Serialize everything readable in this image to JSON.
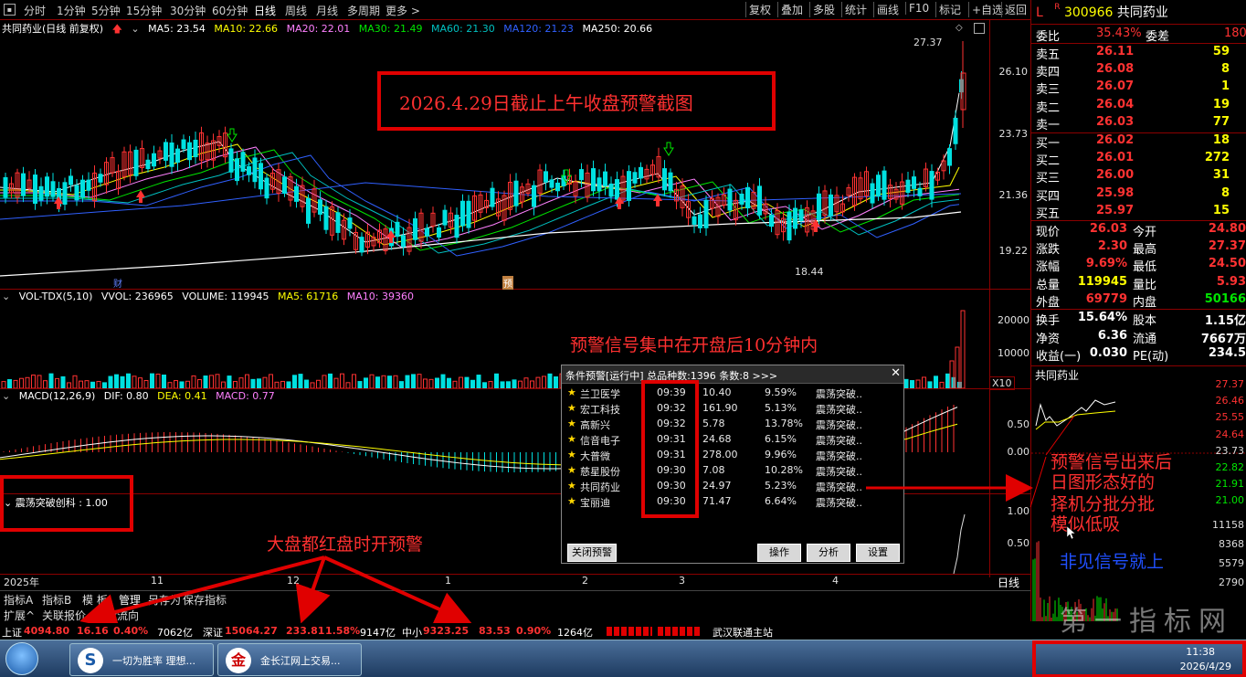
{
  "toolbar": {
    "periods": [
      "分时",
      "1分钟",
      "5分钟",
      "15分钟",
      "30分钟",
      "60分钟",
      "日线",
      "周线",
      "月线",
      "多周期",
      "更多 >"
    ],
    "right_buttons": [
      "复权",
      "叠加",
      "多股",
      "统计",
      "画线",
      "F10",
      "标记",
      "+自选",
      "返回"
    ]
  },
  "ma_line": {
    "title": "共同药业(日线 前复权)",
    "ma5": "MA5: 23.54",
    "ma10": "MA10: 22.66",
    "ma20": "MA20: 22.01",
    "ma30": "MA30: 21.49",
    "ma60": "MA60: 21.30",
    "ma120": "MA120: 21.23",
    "ma250": "MA250: 20.66"
  },
  "price_axis": [
    "26.10",
    "23.73",
    "21.36",
    "19.22"
  ],
  "price_high": "27.37",
  "price_low": "18.44",
  "markers": {
    "cai": "财",
    "yu": "预"
  },
  "vol_line": {
    "label": "VOL-TDX(5,10)",
    "vvol": "VVOL: 236965",
    "volume": "VOLUME: 119945",
    "ma5": "MA5: 61716",
    "ma10": "MA10: 39360"
  },
  "vol_axis": [
    "20000",
    "10000"
  ],
  "vol_unit": "X10",
  "macd_line": {
    "label": "MACD(12,26,9)",
    "dif": "DIF: 0.80",
    "dea": "DEA: 0.41",
    "macd": "MACD: 0.77"
  },
  "macd_axis": [
    "0.50",
    "0.00"
  ],
  "osc_line": {
    "label": "震荡突破创科 : 1.00"
  },
  "osc_axis": [
    "1.00",
    "0.50"
  ],
  "time_axis": [
    "2025年",
    "11",
    "12",
    "1",
    "2",
    "3",
    "4"
  ],
  "daily_label": "日线",
  "tabs": [
    "指标A",
    "指标B",
    "模 板",
    "管理",
    "另存为",
    "保存指标"
  ],
  "tabs2": [
    "扩展^",
    "关联报价",
    "资金流向"
  ],
  "annotations": {
    "title": "2026.4.29日截止上午收盘预警截图",
    "concentrated": "预警信号集中在开盘后10分钟内",
    "all_red": "大盘都红盘时开预警",
    "right1": "预警信号出来后",
    "right2": "日图形态好的",
    "right3": "择机分批分批",
    "right4": "模似低吸",
    "right5": "非见信号就上"
  },
  "alert_panel": {
    "title": "条件预警[运行中] 总品种数:1396 条数:8  >>>",
    "rows": [
      {
        "name": "兰卫医学",
        "time": "09:39",
        "price": "10.40",
        "pct": "9.59%",
        "cond": "震荡突破.."
      },
      {
        "name": "宏工科技",
        "time": "09:32",
        "price": "161.90",
        "pct": "5.13%",
        "cond": "震荡突破.."
      },
      {
        "name": "高新兴",
        "time": "09:32",
        "price": "5.78",
        "pct": "13.78%",
        "cond": "震荡突破.."
      },
      {
        "name": "信音电子",
        "time": "09:31",
        "price": "24.68",
        "pct": "6.15%",
        "cond": "震荡突破.."
      },
      {
        "name": "大普微",
        "time": "09:31",
        "price": "278.00",
        "pct": "9.96%",
        "cond": "震荡突破.."
      },
      {
        "name": "慈星股份",
        "time": "09:30",
        "price": "7.08",
        "pct": "10.28%",
        "cond": "震荡突破.."
      },
      {
        "name": "共同药业",
        "time": "09:30",
        "price": "24.97",
        "pct": "5.23%",
        "cond": "震荡突破.."
      },
      {
        "name": "宝丽迪",
        "time": "09:30",
        "price": "71.47",
        "pct": "6.64%",
        "cond": "震荡突破.."
      }
    ],
    "btn_close": "关闭预警",
    "btn_op": "操作",
    "btn_analyze": "分析",
    "btn_settings": "设置"
  },
  "quote": {
    "code": "300966",
    "name": "共同药业",
    "wb_label": "委比",
    "wb": "35.43%",
    "wc_label": "委差",
    "wc": "180",
    "sells": [
      {
        "l": "卖五",
        "p": "26.11",
        "v": "59"
      },
      {
        "l": "卖四",
        "p": "26.08",
        "v": "8"
      },
      {
        "l": "卖三",
        "p": "26.07",
        "v": "1"
      },
      {
        "l": "卖二",
        "p": "26.04",
        "v": "19"
      },
      {
        "l": "卖一",
        "p": "26.03",
        "v": "77"
      }
    ],
    "buys": [
      {
        "l": "买一",
        "p": "26.02",
        "v": "18"
      },
      {
        "l": "买二",
        "p": "26.01",
        "v": "272"
      },
      {
        "l": "买三",
        "p": "26.00",
        "v": "31"
      },
      {
        "l": "买四",
        "p": "25.98",
        "v": "8"
      },
      {
        "l": "买五",
        "p": "25.97",
        "v": "15"
      }
    ],
    "stats": [
      {
        "l1": "现价",
        "v1": "26.03",
        "l2": "今开",
        "v2": "24.80"
      },
      {
        "l1": "涨跌",
        "v1": "2.30",
        "l2": "最高",
        "v2": "27.37"
      },
      {
        "l1": "涨幅",
        "v1": "9.69%",
        "l2": "最低",
        "v2": "24.50"
      },
      {
        "l1": "总量",
        "v1": "119945",
        "l2": "量比",
        "v2": "5.93"
      },
      {
        "l1": "外盘",
        "v1": "69779",
        "l2": "内盘",
        "v2": "50166"
      }
    ],
    "stats2": [
      {
        "l1": "换手",
        "v1": "15.64%",
        "l2": "股本",
        "v2": "1.15亿"
      },
      {
        "l1": "净资",
        "v1": "6.36",
        "l2": "流通",
        "v2": "7667万"
      },
      {
        "l1": "收益(一)",
        "v1": "0.030",
        "l2": "PE(动)",
        "v2": "234.5"
      }
    ],
    "mini_title": "共同药业",
    "mini_axis": [
      "27.37",
      "26.46",
      "25.55",
      "24.64",
      "23.73",
      "22.82",
      "21.91",
      "21.00"
    ],
    "mini_vol": [
      "11158",
      "8368",
      "5579",
      "2790"
    ]
  },
  "statusbar": {
    "sh_label": "上证",
    "sh": "4094.80",
    "sh_ch": "16.16",
    "sh_pct": "0.40%",
    "sh_amt": "7062亿",
    "sz_label": "深证",
    "sz": "15064.27",
    "sz_ch": "233.81",
    "sz_pct": "1.58%",
    "sz_amt": "9147亿",
    "zx_label": "中小",
    "zx": "9323.25",
    "zx_ch": "83.53",
    "zx_pct": "0.90%",
    "zx_amt": "1264亿",
    "server": "武汉联通主站"
  },
  "taskbar": {
    "app1": "一切为胜率 理想...",
    "app2": "金长江网上交易...",
    "clock": "11:38",
    "date": "2026/4/29"
  },
  "watermark": "第一指标网"
}
